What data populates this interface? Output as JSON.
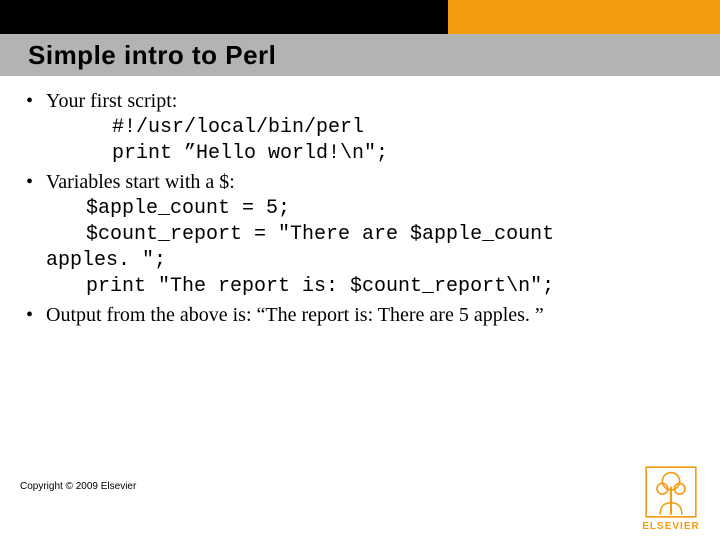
{
  "title": "Simple intro to Perl",
  "bullets": [
    {
      "text": "Your first script:",
      "code": [
        "#!/usr/local/bin/perl",
        "print ”Hello world!\\n\";"
      ]
    },
    {
      "text": "Variables start with a $:",
      "code": [
        "$apple_count = 5;",
        "$count_report = \"There are $apple_count",
        "apples. \";",
        "print \"The report is: $count_report\\n\";"
      ]
    },
    {
      "text": "Output from the above is: “The report is: There are 5 apples. ”"
    }
  ],
  "copyright": "Copyright © 2009 Elsevier",
  "logo_text": "ELSEVIER"
}
